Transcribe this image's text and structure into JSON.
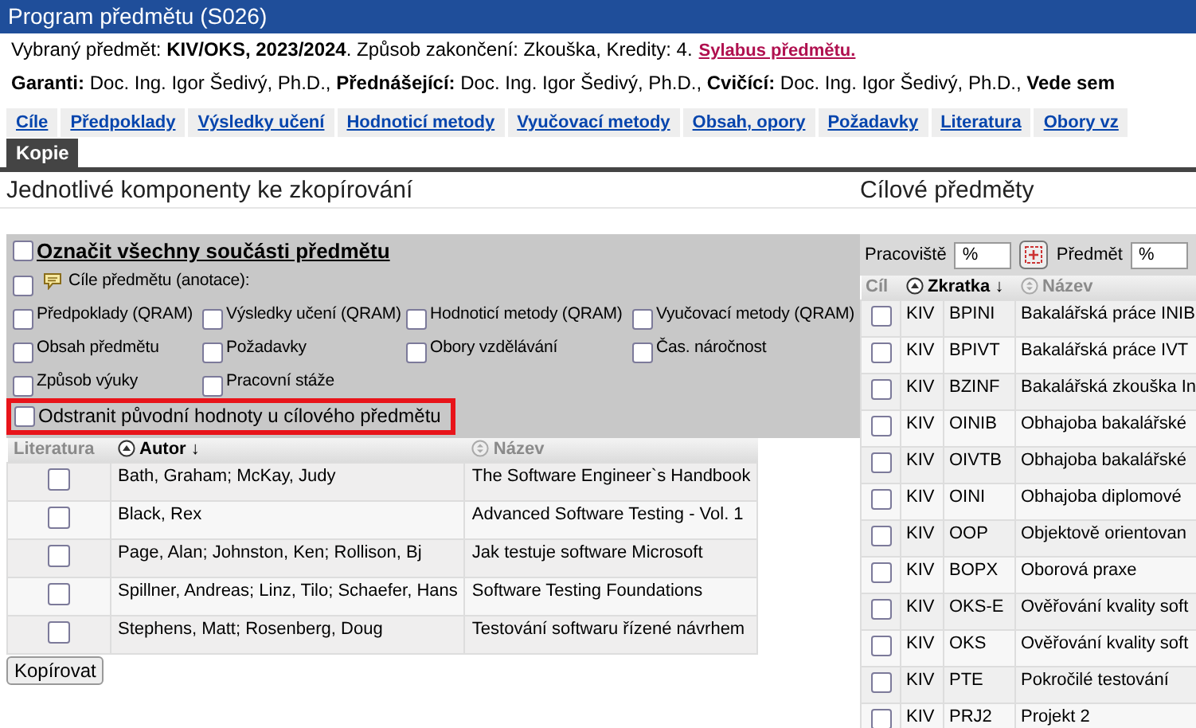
{
  "window": {
    "title": "Program předmětu (S026)"
  },
  "info_line": "Vybraný předmět: **KIV/OKS, 2023/2024**. Způsob zakončení: Zkouška, Kredity: 4.",
  "syllabus_link": "Sylabus předmětu.",
  "staff_line": "**Garanti:** Doc. Ing. Igor Šedivý, Ph.D., **Přednášející:** Doc. Ing. Igor Šedivý, Ph.D., **Cvičící:** Doc. Ing. Igor Šedivý, Ph.D., **Vede sem**",
  "tabs": [
    {
      "label": "Cíle",
      "selected": false
    },
    {
      "label": "Předpoklady",
      "selected": false
    },
    {
      "label": "Výsledky učení",
      "selected": false
    },
    {
      "label": "Hodnoticí metody",
      "selected": false
    },
    {
      "label": "Vyučovací metody",
      "selected": false
    },
    {
      "label": "Obsah, opory",
      "selected": false
    },
    {
      "label": "Požadavky",
      "selected": false
    },
    {
      "label": "Literatura",
      "selected": false
    },
    {
      "label": "Obory vz",
      "selected": false
    }
  ],
  "subtabs": [
    {
      "label": "Kopie",
      "selected": true
    }
  ],
  "components": {
    "title": "Jednotlivé komponenty ke zkopírování",
    "select_all": {
      "label": "Označit všechny součásti předmětu",
      "checked": false
    },
    "options": [
      {
        "label": "Cíle předmětu (anotace):",
        "kind": "annotated",
        "checked": false
      },
      {
        "label": "Předpoklady (QRAM)",
        "kind": "plain",
        "checked": false
      },
      {
        "label": "Výsledky učení (QRAM)",
        "kind": "plain",
        "checked": false
      },
      {
        "label": "Hodnoticí metody (QRAM)",
        "kind": "plain",
        "checked": false
      },
      {
        "label": "Vyučovací metody (QRAM)",
        "kind": "plain",
        "checked": false
      },
      {
        "label": "Obsah předmětu",
        "kind": "plain",
        "checked": false
      },
      {
        "label": "Požadavky",
        "kind": "plain",
        "checked": false
      },
      {
        "label": "Obory vzdělávání",
        "kind": "plain",
        "checked": false
      },
      {
        "label": "Čas. náročnost",
        "kind": "plain",
        "checked": false
      },
      {
        "label": "Způsob výuky",
        "kind": "plain",
        "checked": false
      },
      {
        "label": "Pracovní stáže",
        "kind": "plain",
        "checked": false
      }
    ],
    "remove_original": {
      "label": "Odstranit původní hodnoty u cílového předmětu",
      "checked": false,
      "highlighted": true
    }
  },
  "literature_table": {
    "columns": [
      {
        "label": "Literatura",
        "kind": "plain",
        "sorted": false
      },
      {
        "label": "Autor",
        "kind": "sortable",
        "sorted": true,
        "sort_mark": "↓"
      },
      {
        "label": "Název",
        "kind": "sortable",
        "sorted": false
      }
    ],
    "rows": [
      {
        "checked": false,
        "author": "Bath, Graham; McKay, Judy",
        "title": "The Software Engineer`s Handbook"
      },
      {
        "checked": false,
        "author": "Black, Rex",
        "title": "Advanced Software Testing - Vol. 1"
      },
      {
        "checked": false,
        "author": "Page, Alan; Johnston, Ken; Rollison, Bj",
        "title": "Jak testuje software Microsoft"
      },
      {
        "checked": false,
        "author": "Spillner, Andreas; Linz, Tilo; Schaefer, Hans",
        "title": "Software Testing Foundations"
      },
      {
        "checked": false,
        "author": "Stephens, Matt; Rosenberg, Doug",
        "title": "Testování softwaru řízené návrhem"
      }
    ]
  },
  "copy_button": "Kopírovat",
  "target": {
    "title": "Cílové předměty",
    "filters": [
      {
        "label": "Pracoviště",
        "value": "%",
        "kind": "with_button"
      },
      {
        "label": "Předmět",
        "value": "%",
        "kind": "plain"
      }
    ],
    "columns": [
      {
        "label": "Cíl",
        "kind": "plain",
        "sorted": false
      },
      {
        "label": "Zkratka",
        "kind": "sortable",
        "sorted": true,
        "sort_mark": "↓"
      },
      {
        "label": "Název",
        "kind": "sortable",
        "sorted": false
      }
    ],
    "rows": [
      {
        "checked": false,
        "department": "KIV",
        "code": "BPINI",
        "name": "Bakalářská práce INIB"
      },
      {
        "checked": false,
        "department": "KIV",
        "code": "BPIVT",
        "name": "Bakalářská práce IVT"
      },
      {
        "checked": false,
        "department": "KIV",
        "code": "BZINF",
        "name": "Bakalářská zkouška In"
      },
      {
        "checked": false,
        "department": "KIV",
        "code": "OINIB",
        "name": "Obhajoba bakalářské"
      },
      {
        "checked": false,
        "department": "KIV",
        "code": "OIVTB",
        "name": "Obhajoba bakalářské"
      },
      {
        "checked": false,
        "department": "KIV",
        "code": "OINI",
        "name": "Obhajoba diplomové"
      },
      {
        "checked": false,
        "department": "KIV",
        "code": "OOP",
        "name": "Objektově orientovan"
      },
      {
        "checked": false,
        "department": "KIV",
        "code": "BOPX",
        "name": "Oborová praxe"
      },
      {
        "checked": false,
        "department": "KIV",
        "code": "OKS-E",
        "name": "Ověřování kvality soft"
      },
      {
        "checked": false,
        "department": "KIV",
        "code": "OKS",
        "name": "Ověřování kvality soft"
      },
      {
        "checked": false,
        "department": "KIV",
        "code": "PTE",
        "name": "Pokročilé testování"
      },
      {
        "checked": false,
        "department": "KIV",
        "code": "PRJ2",
        "name": "Projekt 2"
      }
    ]
  }
}
